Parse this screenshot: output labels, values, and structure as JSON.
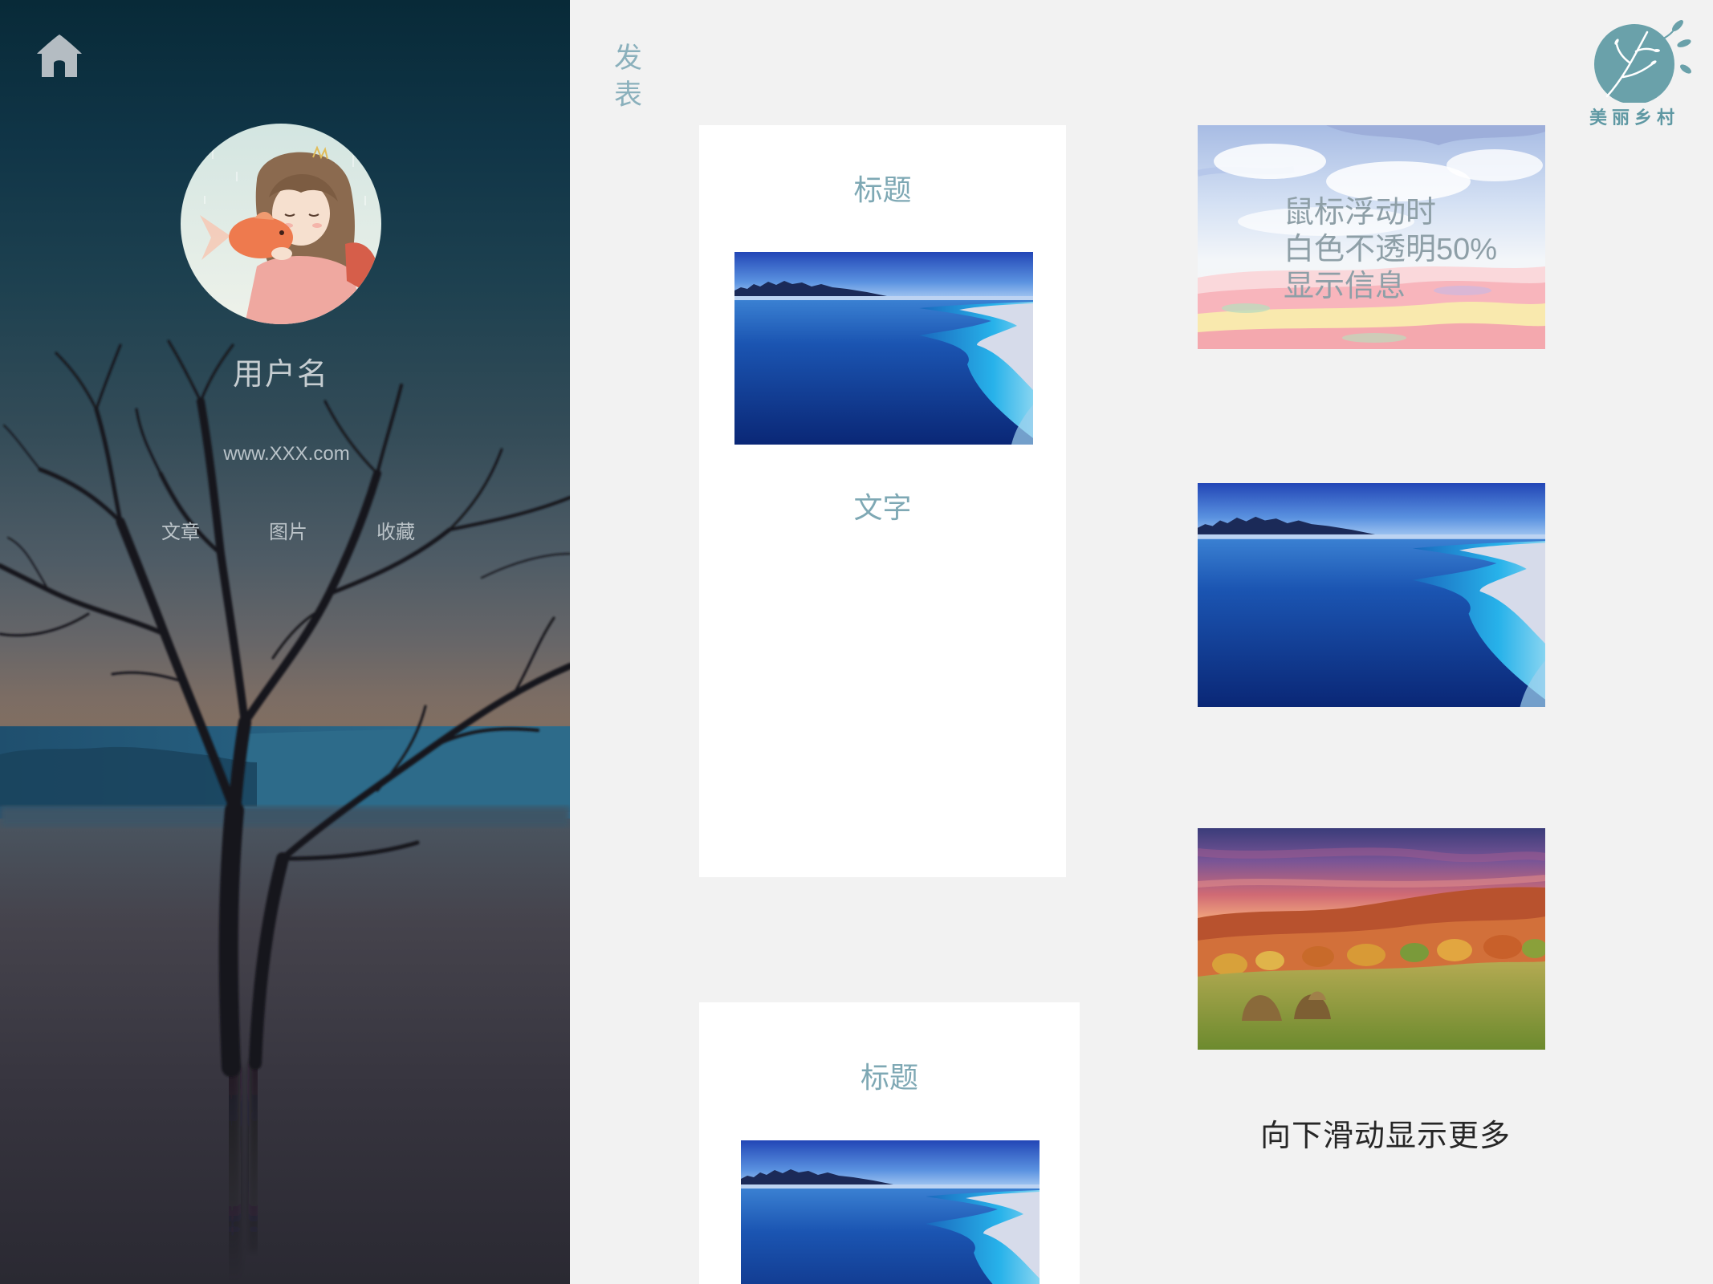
{
  "sidebar": {
    "username": "用户名",
    "website": "www.XXX.com",
    "nav": [
      {
        "label": "文章"
      },
      {
        "label": "图片"
      },
      {
        "label": "收藏"
      }
    ]
  },
  "header": {
    "post_label": "发表",
    "logo_text": "美丽乡村"
  },
  "posts": [
    {
      "title": "标题",
      "text": "文字"
    },
    {
      "title": "标题"
    }
  ],
  "gallery": {
    "hover_lines": [
      "鼠标浮动时",
      "白色不透明50%",
      "显示信息"
    ],
    "more_label": "向下滑动显示更多"
  },
  "icons": {
    "home": "home-icon",
    "logo": "leaf-branch-logo-icon"
  },
  "colors": {
    "accent": "#7ea8b4",
    "logo": "#6aa1aa",
    "page_bg": "#f2f2f2",
    "sidebar_bg": "#0b2d3c",
    "card_bg": "#ffffff"
  }
}
